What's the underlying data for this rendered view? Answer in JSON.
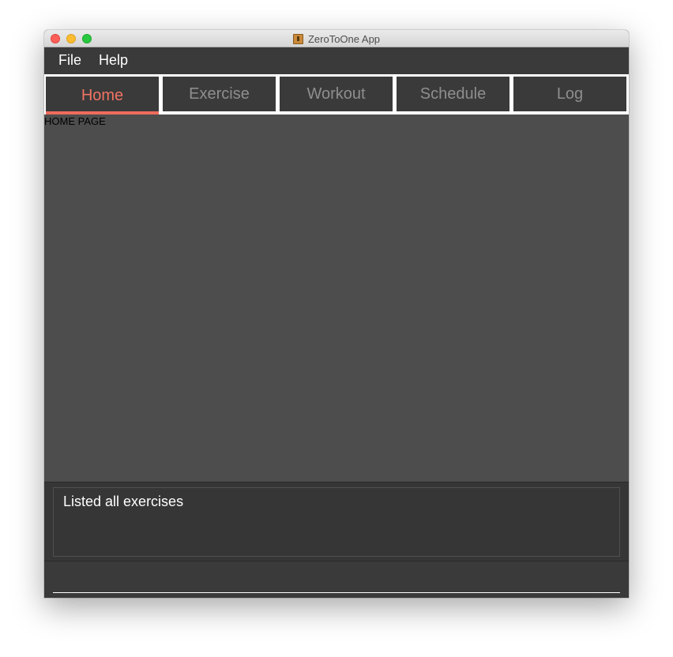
{
  "window": {
    "title": "ZeroToOne App"
  },
  "menu": {
    "items": [
      {
        "label": "File"
      },
      {
        "label": "Help"
      }
    ]
  },
  "tabs": [
    {
      "label": "Home",
      "active": true
    },
    {
      "label": "Exercise",
      "active": false
    },
    {
      "label": "Workout",
      "active": false
    },
    {
      "label": "Schedule",
      "active": false
    },
    {
      "label": "Log",
      "active": false
    }
  ],
  "main": {
    "page_label": "HOME PAGE"
  },
  "result": {
    "message": "Listed all exercises"
  },
  "command": {
    "value": ""
  },
  "colors": {
    "accent": "#ef6c5d",
    "background": "#3a3a3a",
    "content": "#4d4d4d"
  },
  "icons": {
    "app": "app-icon",
    "close": "close-icon",
    "minimize": "minimize-icon",
    "maximize": "maximize-icon"
  }
}
